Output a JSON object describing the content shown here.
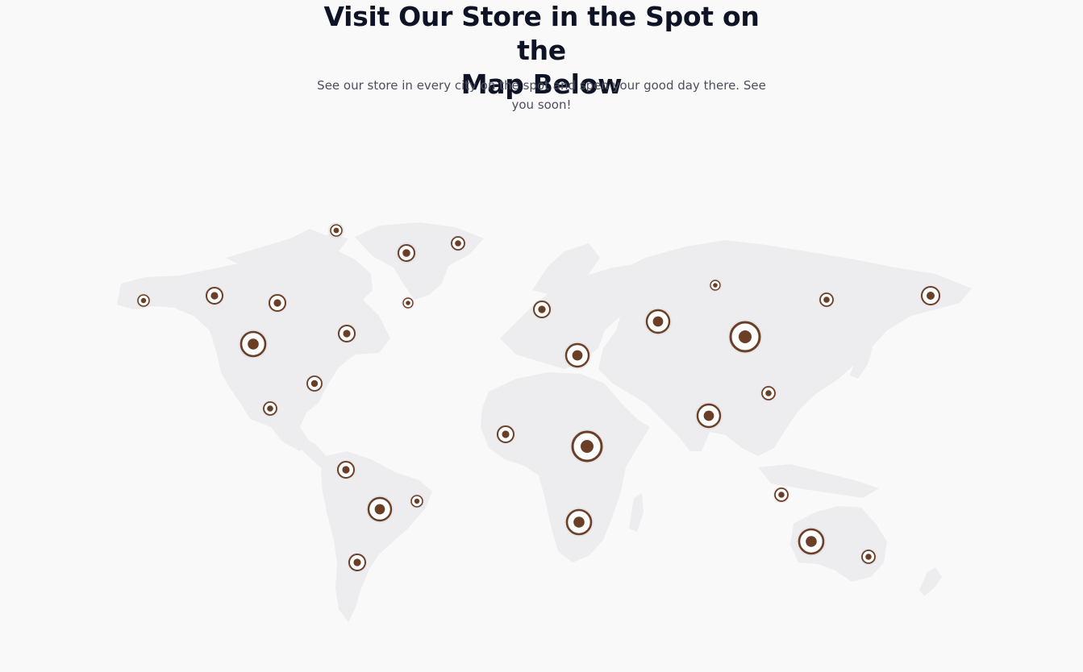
{
  "section": {
    "title": "Visit Our Store in the Spot on the Map Below",
    "title_line1": "Visit Our Store in the Spot on the",
    "title_line2": "Map Below",
    "subtitle_line1": "See our store in every city on the spot and spen your good day there. See",
    "subtitle_line2": "you soon!"
  },
  "map": {
    "marker_icon": "store-location-pin-icon",
    "marker_color": "#6b3f26",
    "land_color": "#ededef",
    "background_color": "#f9f9fa",
    "marker_count": 33
  }
}
